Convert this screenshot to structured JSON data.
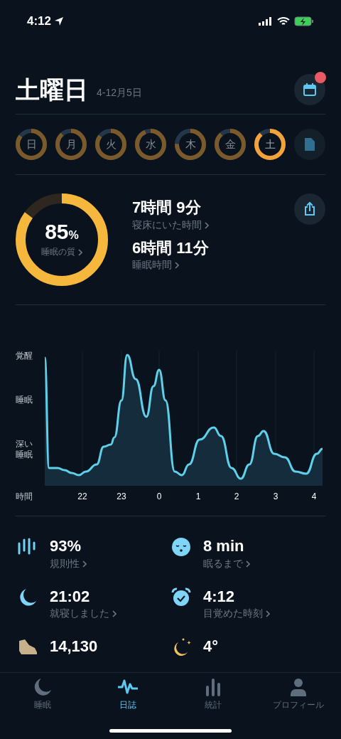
{
  "status_bar": {
    "time": "4:12"
  },
  "header": {
    "title": "土曜日",
    "date_range": "4-12月5日",
    "calendar_badge": true
  },
  "days": [
    {
      "label": "日",
      "level": 0.85,
      "selected": false
    },
    {
      "label": "月",
      "level": 0.88,
      "selected": false
    },
    {
      "label": "火",
      "level": 0.85,
      "selected": false
    },
    {
      "label": "水",
      "level": 0.93,
      "selected": false
    },
    {
      "label": "木",
      "level": 0.75,
      "selected": false
    },
    {
      "label": "金",
      "level": 0.88,
      "selected": false
    },
    {
      "label": "土",
      "level": 0.88,
      "selected": true
    }
  ],
  "summary": {
    "quality": {
      "value": "85",
      "unit": "%",
      "label": "睡眠の質",
      "level": 0.85
    },
    "metrics": [
      {
        "value": "7時間 9分",
        "label": "寝床にいた時間"
      },
      {
        "value": "6時間 11分",
        "label": "睡眠時間"
      }
    ]
  },
  "chart": {
    "y_labels": [
      "覚醒",
      "睡眠",
      "深い睡眠"
    ],
    "x_axis_label": "時間",
    "x_labels": [
      "22",
      "23",
      "0",
      "1",
      "2",
      "3",
      "4"
    ]
  },
  "stats": [
    {
      "kind": "regularity",
      "value": "93%",
      "label": "規則性"
    },
    {
      "kind": "fall_asleep",
      "value": "8 min",
      "label": "眠るまで"
    },
    {
      "kind": "bedtime",
      "value": "21:02",
      "label": "就寝しました"
    },
    {
      "kind": "wake",
      "value": "4:12",
      "label": "目覚めた時刻"
    },
    {
      "kind": "steps",
      "value": "14,130"
    },
    {
      "kind": "weather",
      "value": "4°"
    }
  ],
  "tab_bar": [
    {
      "kind": "sleep",
      "label": "睡眠",
      "selected": false
    },
    {
      "kind": "journal",
      "label": "日誌",
      "selected": true
    },
    {
      "kind": "stats",
      "label": "統計",
      "selected": false
    },
    {
      "kind": "profile",
      "label": "プロフィール",
      "selected": false
    }
  ]
}
